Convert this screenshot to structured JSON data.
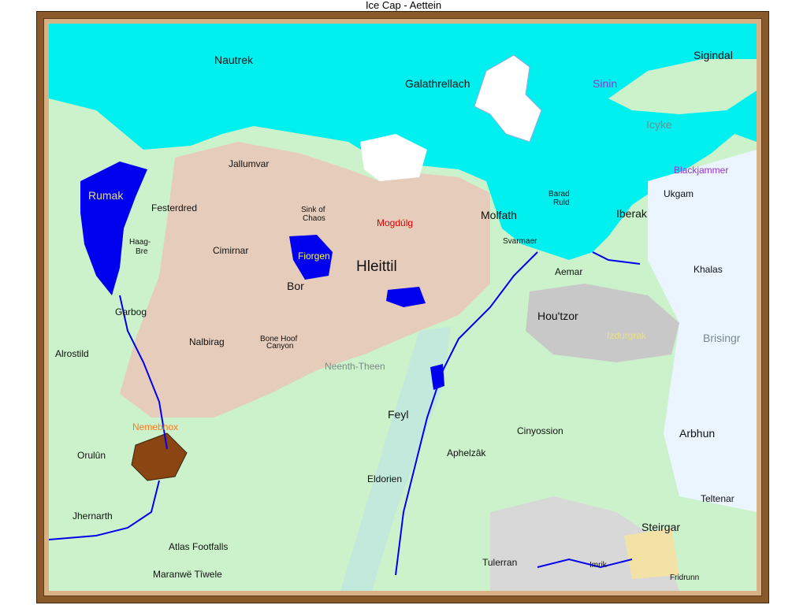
{
  "window": {
    "title": "Ice Cap - Aettein"
  },
  "colors": {
    "sea": "#00f0f0",
    "land": "#ccf2cc",
    "mountain_region": "#e6ccbb",
    "lake": "#0000ee",
    "ice": "#ffffff",
    "frame": "#8b5a2b"
  },
  "labels": {
    "nautrek": "Nautrek",
    "galathrellach": "Galathrellach",
    "sigindal": "Sigindal",
    "sinin": "Sinin",
    "icyke": "Icyke",
    "blackjammer": "Blackjammer",
    "ukgam": "Ukgam",
    "iberak": "Iberak",
    "barad_ruld_1": "Barad",
    "barad_ruld_2": "Ruld",
    "molfath": "Molfath",
    "svarmaer": "Svarmaer",
    "jallumvar": "Jallumvar",
    "rumak": "Rumak",
    "festerdred": "Festerdred",
    "sink_of_chaos_1": "Sink of",
    "sink_of_chaos_2": "Chaos",
    "mogdulg": "Mogdúlg",
    "haag_bre_1": "Haag-",
    "haag_bre_2": "Bre",
    "cimirnar": "Cimirnar",
    "fiorgen": "Fiorgen",
    "hleittil": "Hleittil",
    "bor": "Bor",
    "aemar": "Aemar",
    "khalas": "Khalas",
    "houtzor": "Hou'tzor",
    "izdurgrak": "Izdurgrak",
    "brisingr": "Brisingr",
    "garbog": "Garbog",
    "nalbirag": "Nalbirag",
    "bone_hoof_1": "Bone Hoof",
    "bone_hoof_2": "Canyon",
    "alrostild": "Alrostild",
    "neenth_theen": "Neenth-Theen",
    "feyl": "Feyl",
    "nemebhox": "Nemebhox",
    "cinyossion": "Cinyossion",
    "arbhun": "Arbhun",
    "aphelzak": "Aphelzâk",
    "orulun": "Orulûn",
    "eldorien": "Eldorien",
    "teltenar": "Teltenar",
    "jhernarth": "Jhernarth",
    "steirgar": "Steirgar",
    "atlas_footfalls": "Atlas Footfalls",
    "tulerran": "Tulerran",
    "imrik": "Imrik",
    "maranwe": "Maranwë Tîwele",
    "fridrunn": "Fridrunn"
  }
}
